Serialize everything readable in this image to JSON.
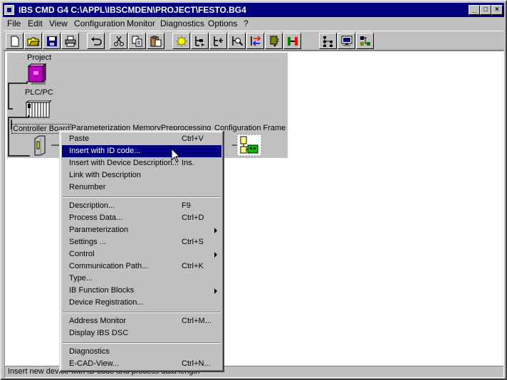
{
  "window": {
    "title": "IBS CMD G4 C:\\APPL\\IBSCMDEN\\PROJECT\\FESTO.BG4",
    "controls": {
      "minimize": "_",
      "maximize": "□",
      "close": "×"
    }
  },
  "menubar": [
    "File",
    "Edit",
    "View",
    "Configuration",
    "Monitor",
    "Diagnostics",
    "Options",
    "?"
  ],
  "toolbar": {
    "icons": [
      "new-file-icon",
      "open-folder-icon",
      "save-disk-icon",
      "print-icon",
      "undo-icon",
      "cut-icon",
      "copy-icon",
      "paste-icon",
      "device-insert-icon",
      "tree-insert-down-icon",
      "tree-insert-left-icon",
      "search-device-icon",
      "swap-icon",
      "plug-icon",
      "start-stop-icon",
      "network-tree-icon",
      "monitor-icon",
      "diagnostics-icon"
    ]
  },
  "tree": {
    "project": "Project",
    "plc": "PLC/PC",
    "columns": [
      "Controller Board",
      "Parameterization Memory",
      "Preprocessing",
      "Configuration Frame"
    ]
  },
  "context_menu": {
    "groups": [
      [
        {
          "label": "Paste",
          "shortcut": "Ctrl+V",
          "submenu": false,
          "highlighted": false
        },
        {
          "label": "Insert with ID code...",
          "shortcut": "",
          "submenu": false,
          "highlighted": true
        },
        {
          "label": "Insert with Device Description...",
          "shortcut": "Ins.",
          "submenu": false,
          "highlighted": false
        },
        {
          "label": "Link with Description",
          "shortcut": "",
          "submenu": false,
          "highlighted": false
        },
        {
          "label": "Renumber",
          "shortcut": "",
          "submenu": false,
          "highlighted": false
        }
      ],
      [
        {
          "label": "Description...",
          "shortcut": "F9",
          "submenu": false,
          "highlighted": false
        },
        {
          "label": "Process Data...",
          "shortcut": "Ctrl+D",
          "submenu": false,
          "highlighted": false
        },
        {
          "label": "Parameterization",
          "shortcut": "",
          "submenu": true,
          "highlighted": false
        },
        {
          "label": "Settings ...",
          "shortcut": "Ctrl+S",
          "submenu": false,
          "highlighted": false
        },
        {
          "label": "Control",
          "shortcut": "",
          "submenu": true,
          "highlighted": false
        },
        {
          "label": "Communication Path...",
          "shortcut": "Ctrl+K",
          "submenu": false,
          "highlighted": false
        },
        {
          "label": "Type...",
          "shortcut": "",
          "submenu": false,
          "highlighted": false
        },
        {
          "label": "IB Function Blocks",
          "shortcut": "",
          "submenu": true,
          "highlighted": false
        },
        {
          "label": "Device Registration...",
          "shortcut": "",
          "submenu": false,
          "highlighted": false
        }
      ],
      [
        {
          "label": "Address Monitor",
          "shortcut": "Ctrl+M...",
          "submenu": false,
          "highlighted": false
        },
        {
          "label": "Display IBS DSC",
          "shortcut": "",
          "submenu": false,
          "highlighted": false
        }
      ],
      [
        {
          "label": "Diagnostics",
          "shortcut": "",
          "submenu": false,
          "highlighted": false
        },
        {
          "label": "E-CAD-View...",
          "shortcut": "Ctrl+N...",
          "submenu": false,
          "highlighted": false
        }
      ]
    ]
  },
  "status": "Insert new device with ID code and process data length"
}
